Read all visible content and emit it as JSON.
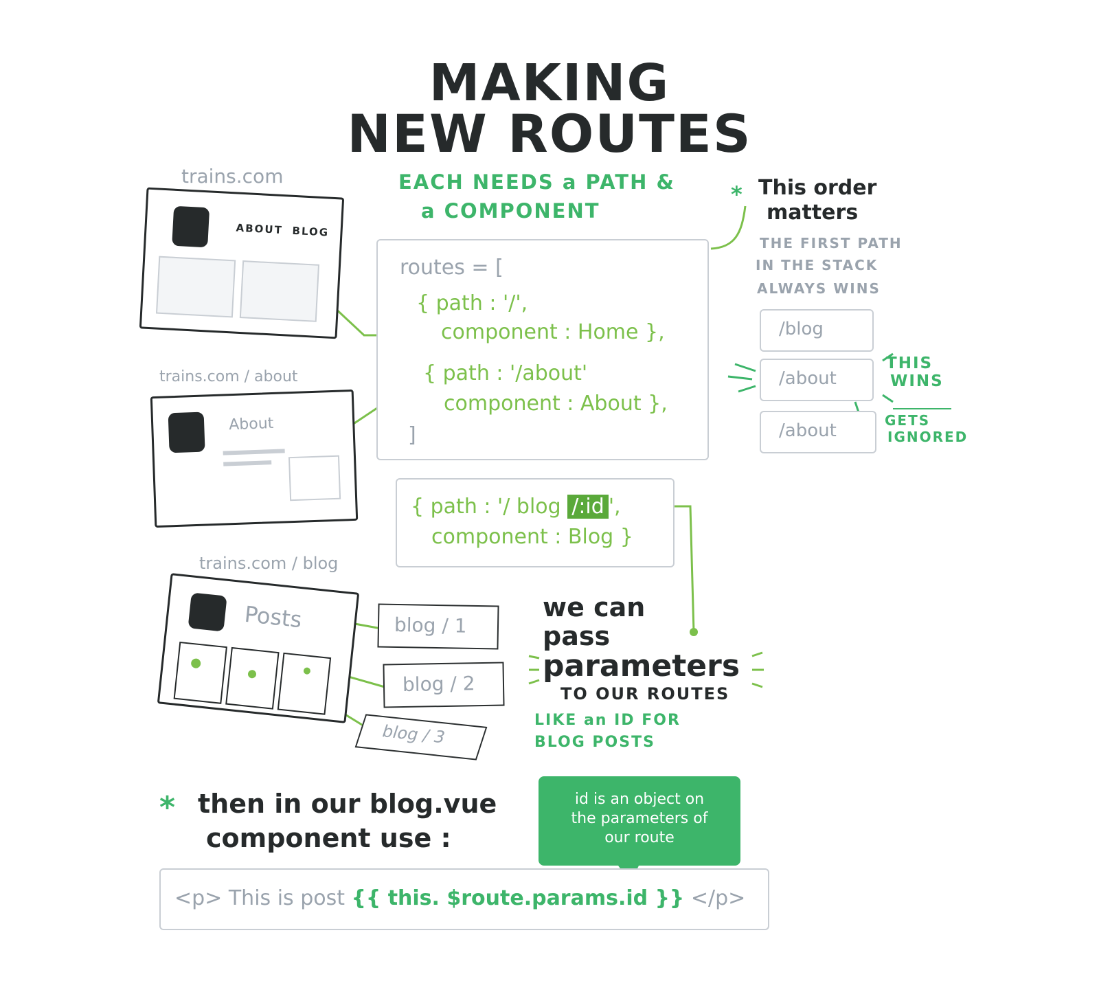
{
  "title": {
    "line1": "MAKING",
    "line2": "NEW ROUTES"
  },
  "subtitle": {
    "line1": "EACH NEEDS a PATH &",
    "line2": "a COMPONENT"
  },
  "order_note": {
    "heading1": "This order",
    "heading2": "matters",
    "body1": "THE FIRST PATH",
    "body2": "IN THE STACK",
    "body3": "ALWAYS WINS",
    "stack": [
      "/blog",
      "/about",
      "/about"
    ],
    "wins_label1": "THIS",
    "wins_label2": "WINS",
    "ignored_label1": "GETS",
    "ignored_label2": "IGNORED"
  },
  "routes_code": {
    "open": "routes = [",
    "home_path": "{ path : '/',",
    "home_component": "component : Home },",
    "about_path": "{ path : '/about'",
    "about_component": "component : About },",
    "close": "]"
  },
  "param_code": {
    "path_prefix": "{ path : '/ blog",
    "param": "/:id",
    "path_suffix": "',",
    "component": "component : Blog }"
  },
  "sites": {
    "home_url": "trains.com",
    "home_nav_about": "ABOUT",
    "home_nav_blog": "BLOG",
    "about_url": "trains.com / about",
    "about_heading": "About",
    "blog_url": "trains.com / blog",
    "blog_heading": "Posts"
  },
  "blog_links": [
    "blog / 1",
    "blog / 2",
    "blog / 3"
  ],
  "params_note": {
    "line1": "we can",
    "line2": "pass",
    "line3": "parameters",
    "line4": "TO OUR ROUTES",
    "sub1": "LIKE an ID FOR",
    "sub2": "BLOG POSTS"
  },
  "bottom": {
    "line1": "then in our blog.vue",
    "line2": "component use :",
    "code_prefix": "<p> This is post",
    "code_expr": "{{ this. $route.params.id }}",
    "code_suffix": "</p>",
    "bubble1": "id is an object on",
    "bubble2": "the parameters of",
    "bubble3": "our route"
  },
  "colors": {
    "green": "#3db56a",
    "lime": "#7cc04b",
    "grey": "#9aa3ad",
    "ink": "#262a2b"
  }
}
